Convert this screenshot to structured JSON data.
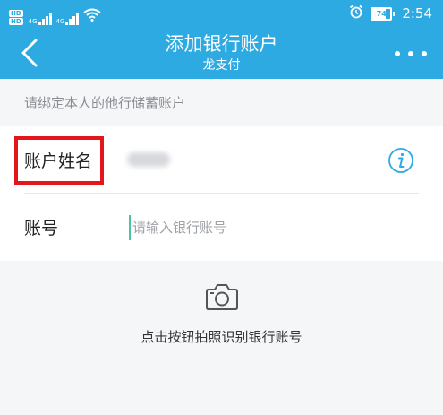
{
  "status_bar": {
    "left_badges": [
      "HD",
      "HD"
    ],
    "signal_labels": [
      "4G",
      "4G"
    ],
    "battery_level": "74",
    "time": "2:54",
    "icons": [
      "signal-icon",
      "wifi-icon",
      "alarm-icon",
      "battery-icon"
    ]
  },
  "header": {
    "title": "添加银行账户",
    "subtitle": "龙支付",
    "background_color": "#2eaae3"
  },
  "hint": "请绑定本人的他行储蓄账户",
  "form": {
    "name_label": "账户姓名",
    "account_label": "账号",
    "account_placeholder": "请输入银行账号"
  },
  "camera": {
    "text": "点击按钮拍照识别银行账号"
  },
  "colors": {
    "accent": "#2eaae3",
    "highlight_box": "#e4161c"
  }
}
